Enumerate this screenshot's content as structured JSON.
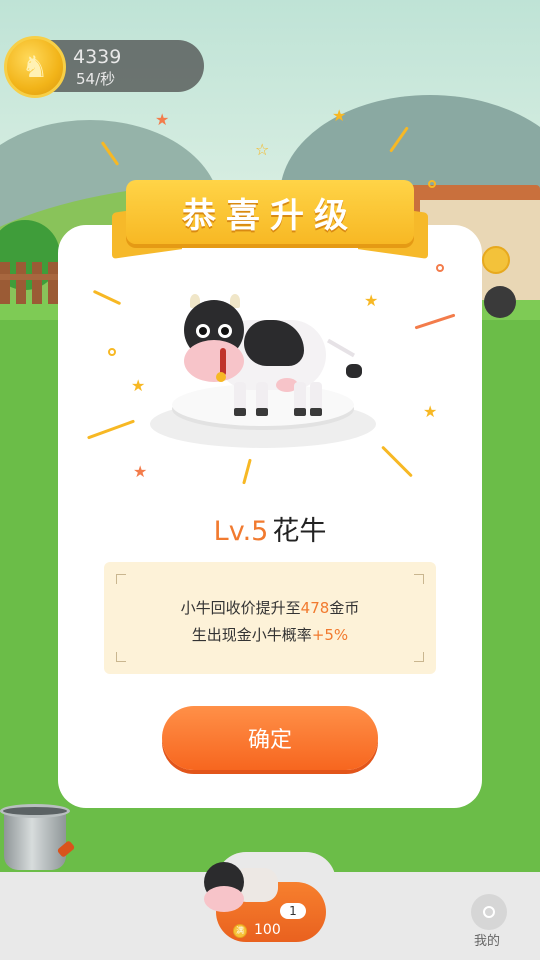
{
  "hud": {
    "coins": "4339",
    "rate": "54/秒",
    "coin_icon": "goat-coin-icon"
  },
  "dialog": {
    "ribbon_title": "恭喜升级",
    "level": "Lv.5",
    "cow_name": "花牛",
    "info": {
      "line1_prefix": "小牛回收价提升至",
      "line1_value": "478",
      "line1_suffix": "金币",
      "line2_prefix": "生出现金小牛概率",
      "line2_value": "+5%"
    },
    "confirm_label": "确定"
  },
  "bottom": {
    "buy_level": "1",
    "buy_price": "100",
    "buy_coin_glyph": "满",
    "mine_label": "我的"
  },
  "colors": {
    "accent_orange": "#f17a2f",
    "ribbon_yellow": "#f7b824",
    "grass_green": "#6bbd48"
  }
}
